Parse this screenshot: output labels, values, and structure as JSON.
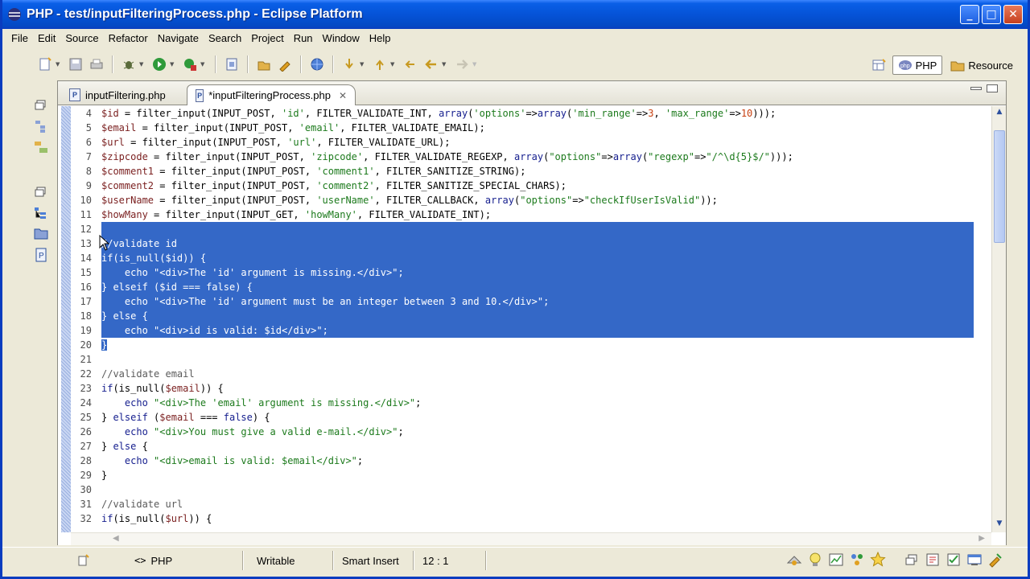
{
  "window": {
    "title": "PHP - test/inputFilteringProcess.php - Eclipse Platform"
  },
  "menu": [
    "File",
    "Edit",
    "Source",
    "Refactor",
    "Navigate",
    "Search",
    "Project",
    "Run",
    "Window",
    "Help"
  ],
  "perspectives": {
    "php": "PHP",
    "resource": "Resource"
  },
  "tabs": [
    {
      "label": "inputFiltering.php",
      "active": false
    },
    {
      "label": "*inputFilteringProcess.php",
      "active": true
    }
  ],
  "code": [
    {
      "n": "4",
      "t": "$id = filter_input(INPUT_POST, 'id', FILTER_VALIDATE_INT, array('options'=>array('min_range'=>3, 'max_range'=>10)));",
      "sel": false
    },
    {
      "n": "5",
      "t": "$email = filter_input(INPUT_POST, 'email', FILTER_VALIDATE_EMAIL);",
      "sel": false
    },
    {
      "n": "6",
      "t": "$url = filter_input(INPUT_POST, 'url', FILTER_VALIDATE_URL);",
      "sel": false
    },
    {
      "n": "7",
      "t": "$zipcode = filter_input(INPUT_POST, 'zipcode', FILTER_VALIDATE_REGEXP, array(\"options\"=>array(\"regexp\"=>\"/^\\d{5}$/\")));",
      "sel": false
    },
    {
      "n": "8",
      "t": "$comment1 = filter_input(INPUT_POST, 'comment1', FILTER_SANITIZE_STRING);",
      "sel": false
    },
    {
      "n": "9",
      "t": "$comment2 = filter_input(INPUT_POST, 'comment2', FILTER_SANITIZE_SPECIAL_CHARS);",
      "sel": false
    },
    {
      "n": "10",
      "t": "$userName = filter_input(INPUT_POST, 'userName', FILTER_CALLBACK, array(\"options\"=>\"checkIfUserIsValid\"));",
      "sel": false
    },
    {
      "n": "11",
      "t": "$howMany = filter_input(INPUT_GET, 'howMany', FILTER_VALIDATE_INT);",
      "sel": false
    },
    {
      "n": "12",
      "t": "",
      "sel": true
    },
    {
      "n": "13",
      "t": "//validate id",
      "sel": true
    },
    {
      "n": "14",
      "t": "if(is_null($id)) {",
      "sel": true
    },
    {
      "n": "15",
      "t": "    echo \"<div>The 'id' argument is missing.</div>\";",
      "sel": true
    },
    {
      "n": "16",
      "t": "} elseif ($id === false) {",
      "sel": true
    },
    {
      "n": "17",
      "t": "    echo \"<div>The 'id' argument must be an integer between 3 and 10.</div>\";",
      "sel": true
    },
    {
      "n": "18",
      "t": "} else {",
      "sel": true
    },
    {
      "n": "19",
      "t": "    echo \"<div>id is valid: $id</div>\";",
      "sel": true
    },
    {
      "n": "20",
      "t": "}",
      "sel": "partial"
    },
    {
      "n": "21",
      "t": "",
      "sel": false
    },
    {
      "n": "22",
      "t": "//validate email",
      "sel": false
    },
    {
      "n": "23",
      "t": "if(is_null($email)) {",
      "sel": false
    },
    {
      "n": "24",
      "t": "    echo \"<div>The 'email' argument is missing.</div>\";",
      "sel": false
    },
    {
      "n": "25",
      "t": "} elseif ($email === false) {",
      "sel": false
    },
    {
      "n": "26",
      "t": "    echo \"<div>You must give a valid e-mail.</div>\";",
      "sel": false
    },
    {
      "n": "27",
      "t": "} else {",
      "sel": false
    },
    {
      "n": "28",
      "t": "    echo \"<div>email is valid: $email</div>\";",
      "sel": false
    },
    {
      "n": "29",
      "t": "}",
      "sel": false
    },
    {
      "n": "30",
      "t": "",
      "sel": false
    },
    {
      "n": "31",
      "t": "//validate url",
      "sel": false
    },
    {
      "n": "32",
      "t": "if(is_null($url)) {",
      "sel": false
    }
  ],
  "status": {
    "lang": "PHP",
    "mode": "Writable",
    "insert": "Smart Insert",
    "position": "12 : 1"
  },
  "colors": {
    "selection": "#3468c7",
    "titlebar": "#0553d8",
    "chrome": "#ece9d8"
  }
}
